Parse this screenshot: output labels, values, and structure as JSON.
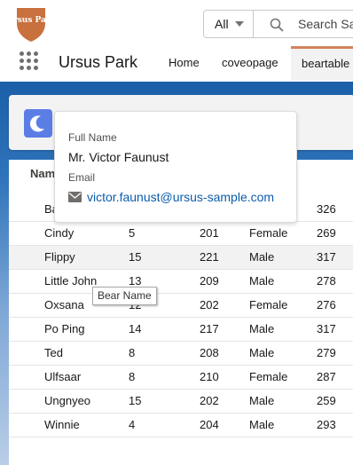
{
  "header": {
    "logo_text": "Ursus Park",
    "search": {
      "scope": "All",
      "placeholder": "Search Sal"
    },
    "app_name": "Ursus Park",
    "tabs": [
      {
        "label": "Home"
      },
      {
        "label": "coveopage"
      },
      {
        "label": "beartable"
      }
    ],
    "accent_color": "#d1845a"
  },
  "table": {
    "header_visible": "Nam",
    "rows": [
      {
        "name": "Ba",
        "age": "",
        "height": "",
        "sex": "",
        "weight": "326"
      },
      {
        "name": "Cindy",
        "age": "5",
        "height": "201",
        "sex": "Female",
        "weight": "269"
      },
      {
        "name": "Flippy",
        "age": "15",
        "height": "221",
        "sex": "Male",
        "weight": "317"
      },
      {
        "name": "Little John",
        "age": "13",
        "height": "209",
        "sex": "Male",
        "weight": "278"
      },
      {
        "name": "Oxsana",
        "age": "12",
        "height": "202",
        "sex": "Female",
        "weight": "276"
      },
      {
        "name": "Po Ping",
        "age": "14",
        "height": "217",
        "sex": "Male",
        "weight": "317"
      },
      {
        "name": "Ted",
        "age": "8",
        "height": "208",
        "sex": "Male",
        "weight": "279"
      },
      {
        "name": "Ulfsaar",
        "age": "8",
        "height": "210",
        "sex": "Female",
        "weight": "287"
      },
      {
        "name": "Ungnyeo",
        "age": "15",
        "height": "202",
        "sex": "Male",
        "weight": "259"
      },
      {
        "name": "Winnie",
        "age": "4",
        "height": "204",
        "sex": "Male",
        "weight": "293"
      }
    ]
  },
  "hovercard": {
    "full_name_label": "Full Name",
    "full_name": "Mr. Victor Faunust",
    "email_label": "Email",
    "email": "victor.faunust@ursus-sample.com"
  },
  "tooltip": {
    "text": "Bear Name"
  }
}
